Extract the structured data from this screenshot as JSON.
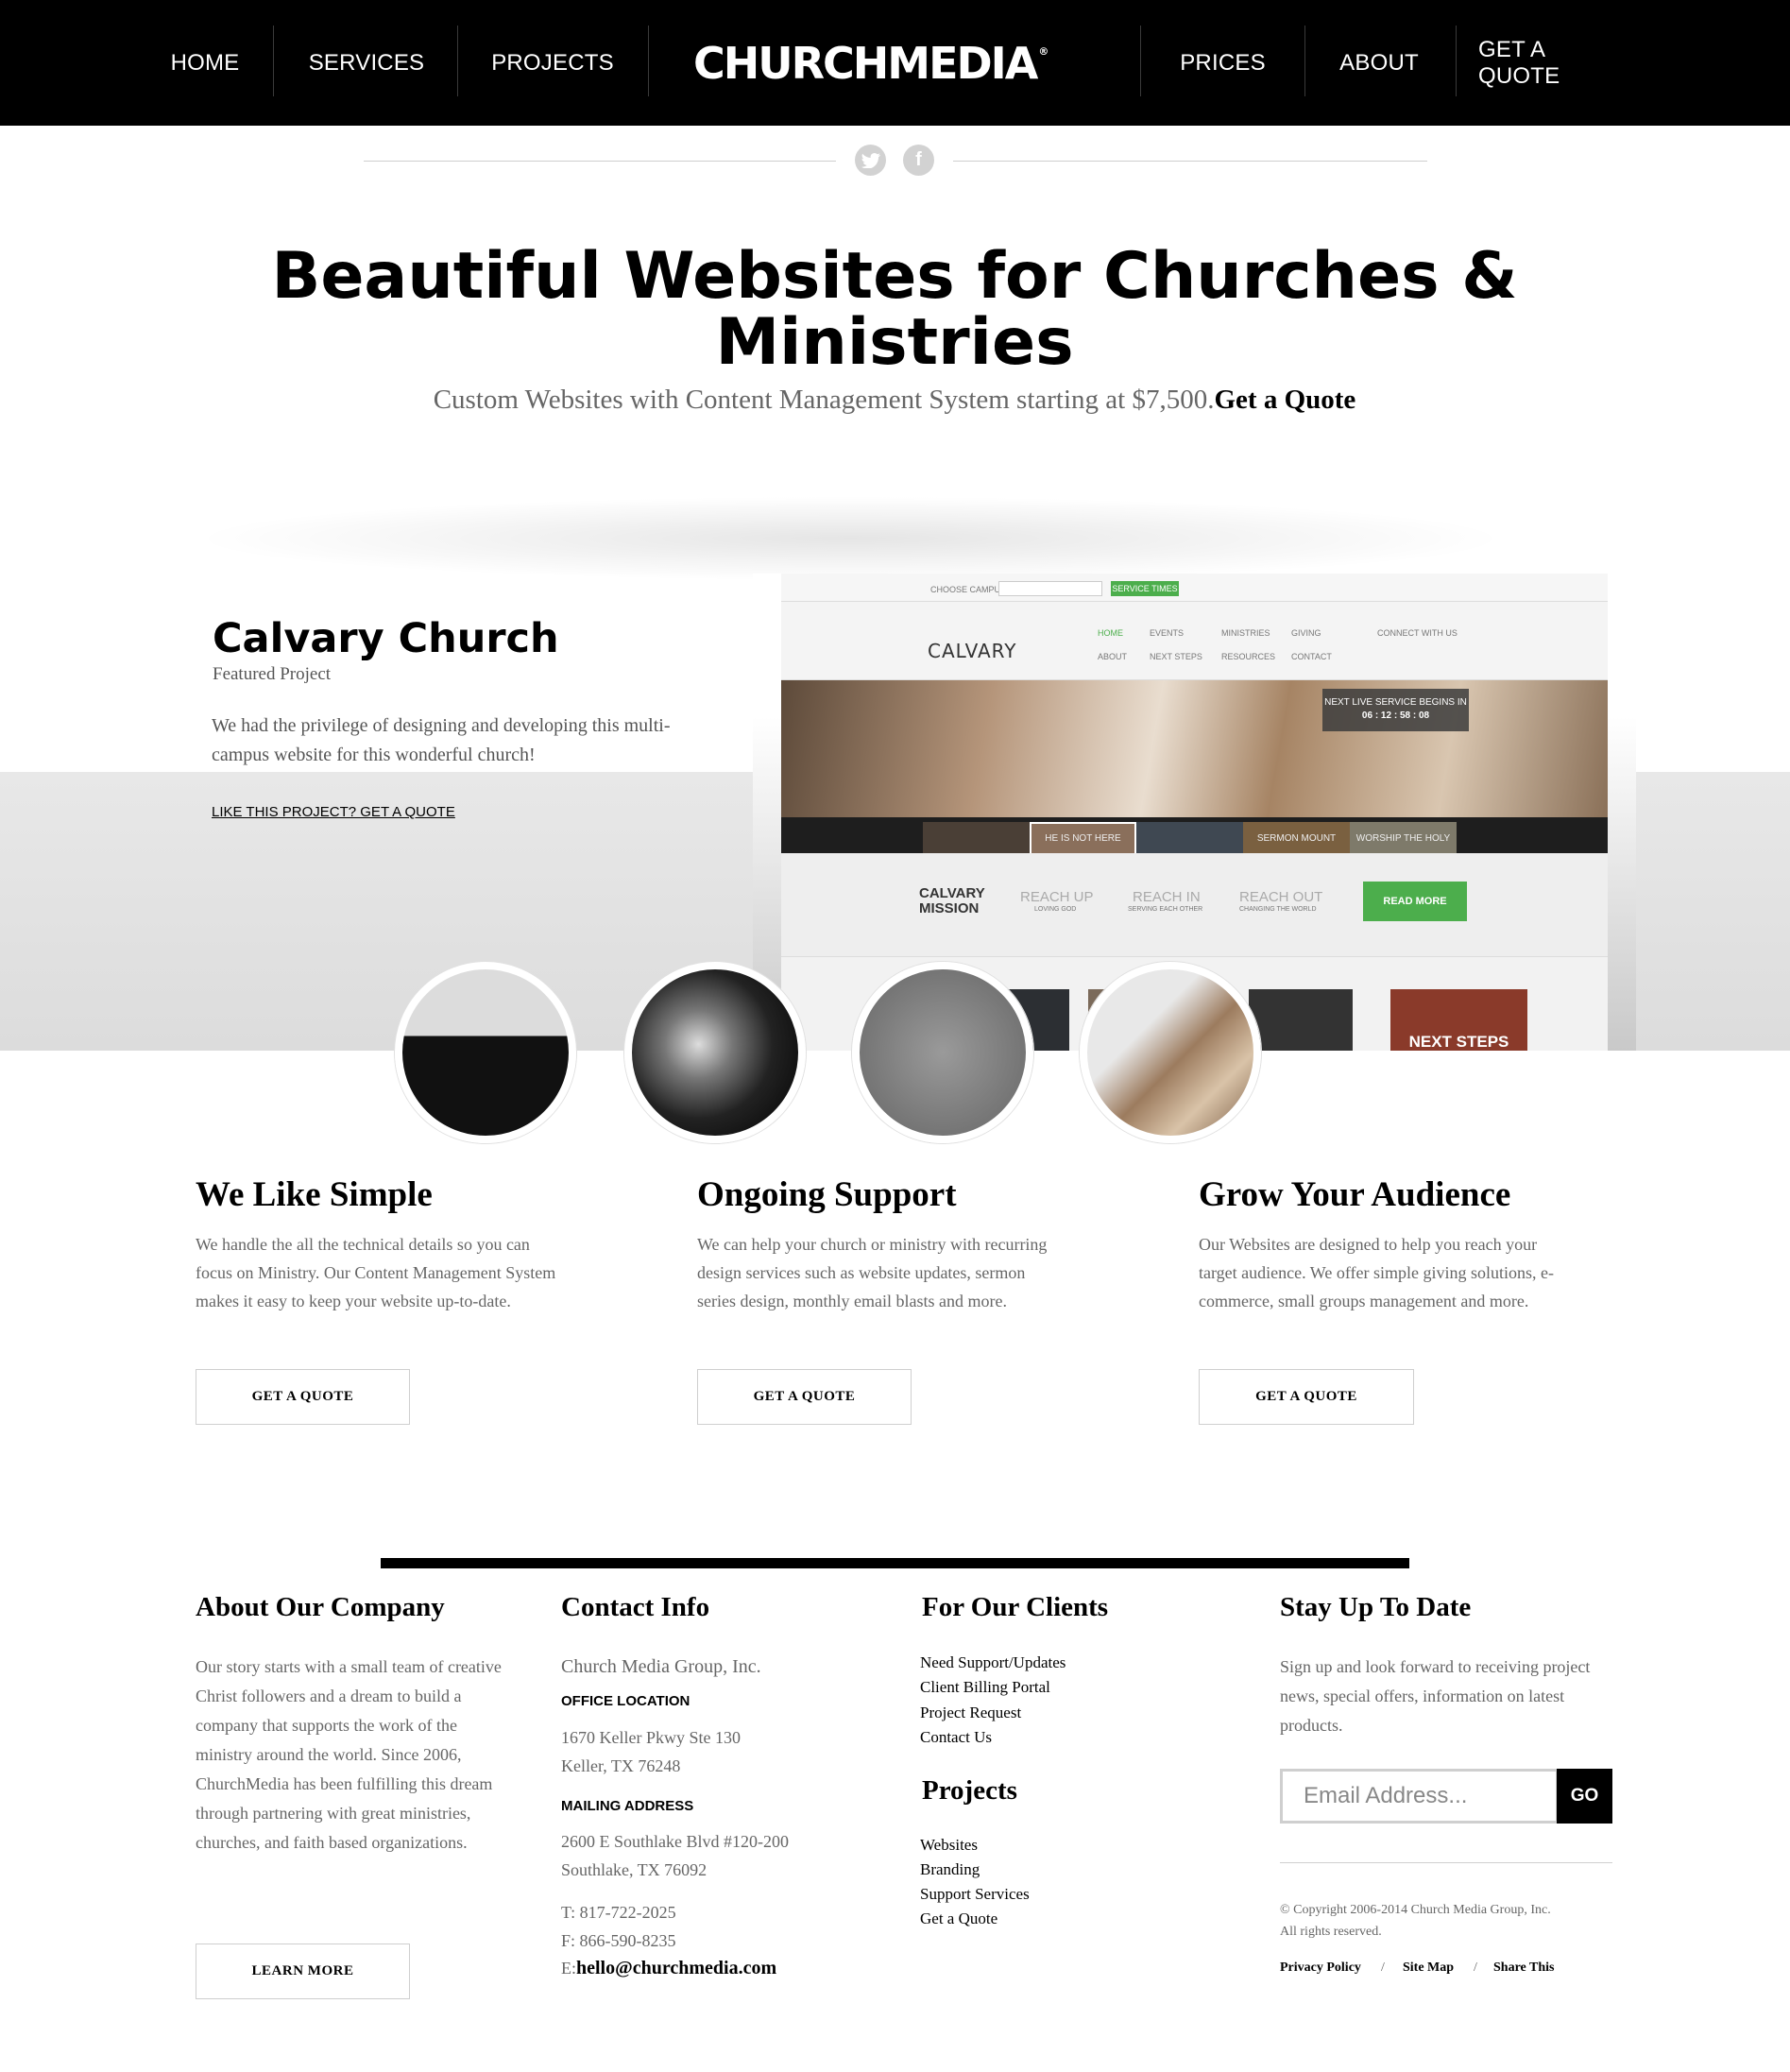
{
  "nav": {
    "home": "HOME",
    "services": "SERVICES",
    "projects": "PROJECTS",
    "logo": "CHURCHMEDIA",
    "prices": "PRICES",
    "about": "ABOUT",
    "quote": "GET A QUOTE"
  },
  "social": {
    "twitter_icon": "twitter-icon",
    "facebook_icon": "facebook-icon"
  },
  "hero": {
    "title": "Beautiful Websites for Churches & Ministries",
    "subtitle": "Custom Websites with Content Management System starting at $7,500.",
    "subtitle_link": "Get a Quote"
  },
  "featured": {
    "title": "Calvary Church",
    "subtitle": "Featured Project",
    "description": "We had the privilege of designing and developing this multi-campus website for this wonderful church!",
    "link": "LIKE THIS PROJECT? GET A QUOTE",
    "mock": {
      "campus_label": "CHOOSE CAMPUS",
      "service_times": "SERVICE TIMES",
      "logo": "CALVARY",
      "nav": [
        "HOME",
        "EVENTS",
        "MINISTRIES",
        "GIVING",
        "ABOUT",
        "NEXT STEPS",
        "RESOURCES",
        "CONTACT"
      ],
      "connect": "CONNECT WITH US",
      "badge_line1": "NEXT LIVE SERVICE BEGINS IN",
      "badge_line2": "06 : 12 : 58 : 08",
      "thumbs": [
        "HE IS NOT HERE",
        "SERMON MOUNT",
        "WORSHIP THE HOLY"
      ],
      "mission": "CALVARY MISSION",
      "reach": [
        "REACH UP",
        "REACH IN",
        "REACH OUT"
      ],
      "reach_sub": [
        "LOVING GOD",
        "SERVING EACH OTHER",
        "CHANGING THE WORLD"
      ],
      "read_more": "READ MORE",
      "next_steps": "NEXT STEPS"
    }
  },
  "features": [
    {
      "title": "We Like Simple",
      "text": "We handle the all the technical details so you can focus on Ministry. Our Content Management System makes it easy to keep your website up-to-date.",
      "button": "GET A QUOTE"
    },
    {
      "title": "Ongoing Support",
      "text": "We can help your church or ministry with recurring design services such as website updates, sermon series design, monthly email blasts and more.",
      "button": "GET A QUOTE"
    },
    {
      "title": "Grow Your Audience",
      "text": "Our Websites are designed to help you reach your target audience. We offer simple giving solutions, e-commerce, small groups management and more.",
      "button": "GET A QUOTE"
    }
  ],
  "footer": {
    "about": {
      "title": "About Our Company",
      "text": "Our story starts with a small team of creative Christ followers and a dream to build a company that supports the work of the ministry around the world. Since 2006, ChurchMedia has been fulfilling this dream through partnering with great ministries, churches, and faith based organizations.",
      "button": "LEARN MORE"
    },
    "contact": {
      "title": "Contact Info",
      "company": "Church Media Group, Inc.",
      "office_label": "OFFICE LOCATION",
      "office_line1": "1670 Keller Pkwy Ste 130",
      "office_line2": "Keller, TX 76248",
      "mailing_label": "MAILING ADDRESS",
      "mailing_line1": "2600 E Southlake Blvd #120-200",
      "mailing_line2": "Southlake, TX 76092",
      "phone": "T: 817-722-2025",
      "fax": "F: 866-590-8235",
      "email_prefix": "E:",
      "email": "hello@churchmedia.com"
    },
    "clients": {
      "title": "For Our Clients",
      "links": [
        "Need Support/Updates",
        "Client Billing Portal",
        "Project Request",
        "Contact Us"
      ]
    },
    "projects": {
      "title": "Projects",
      "links": [
        "Websites",
        "Branding",
        "Support Services",
        "Get a Quote"
      ]
    },
    "newsletter": {
      "title": "Stay Up To Date",
      "text": "Sign up and look forward to receiving project news, special offers, information on latest products.",
      "placeholder": "Email Address...",
      "go": "GO"
    },
    "copyright_line1": "© Copyright 2006-2014 Church Media Group, Inc.",
    "copyright_line2": "All rights reserved.",
    "legal": [
      "Privacy Policy",
      "Site Map",
      "Share This"
    ]
  }
}
